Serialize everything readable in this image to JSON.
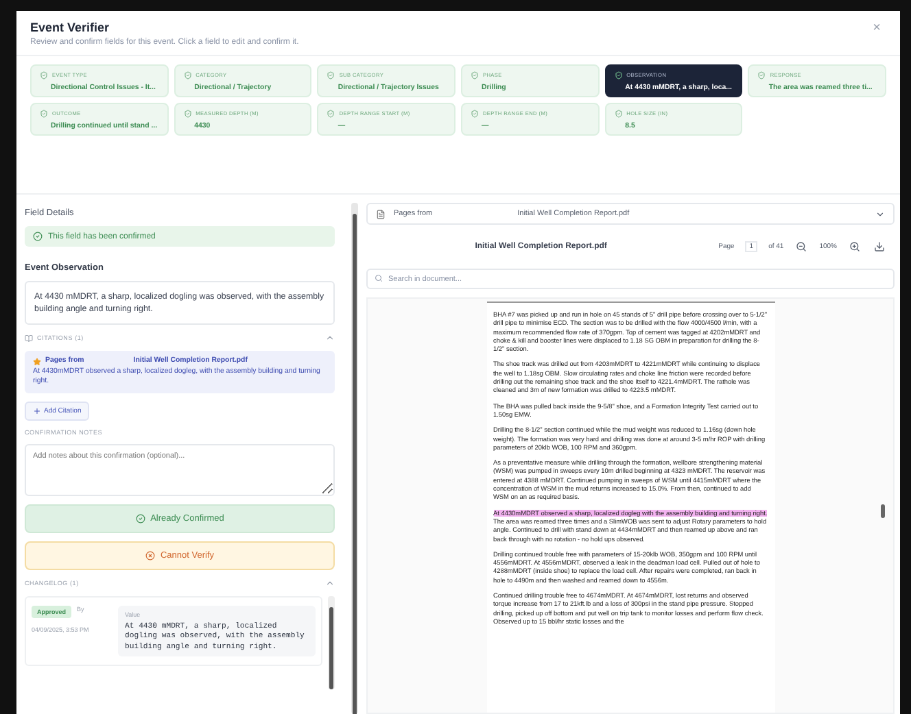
{
  "dialog": {
    "title": "Event Verifier",
    "subtitle": "Review and confirm fields for this event. Click a field to edit and confirm it.",
    "close": "×"
  },
  "fields": [
    {
      "label": "EVENT TYPE",
      "value": "Directional Control Issues - It...",
      "confirmed": true,
      "selected": false
    },
    {
      "label": "CATEGORY",
      "value": "Directional / Trajectory",
      "confirmed": true,
      "selected": false
    },
    {
      "label": "SUB CATEGORY",
      "value": "Directional / Trajectory Issues",
      "confirmed": true,
      "selected": false
    },
    {
      "label": "PHASE",
      "value": "Drilling",
      "confirmed": true,
      "selected": false
    },
    {
      "label": "OBSERVATION",
      "value": "At 4430 mMDRT, a sharp, loca...",
      "confirmed": true,
      "selected": true
    },
    {
      "label": "RESPONSE",
      "value": "The area was reamed three ti...",
      "confirmed": true,
      "selected": false
    },
    {
      "label": "OUTCOME",
      "value": "Drilling continued until stand ...",
      "confirmed": true,
      "selected": false
    },
    {
      "label": "MEASURED DEPTH (M)",
      "value": "4430",
      "confirmed": true,
      "selected": false
    },
    {
      "label": "DEPTH RANGE START (M)",
      "value": "—",
      "confirmed": true,
      "selected": false
    },
    {
      "label": "DEPTH RANGE END (M)",
      "value": "—",
      "confirmed": true,
      "selected": false
    },
    {
      "label": "HOLE SIZE (IN)",
      "value": "8.5",
      "confirmed": true,
      "selected": false
    }
  ],
  "details": {
    "heading": "Field Details",
    "status": "This field has been confirmed",
    "field_title": "Event Observation",
    "value": "At 4430 mMDRT, a sharp, localized dogling was observed, with the assembly building angle and turning right.",
    "citations": {
      "label": "CITATIONS (1)",
      "expanded": true,
      "items": [
        {
          "source": "Pages from",
          "file": "Initial Well Completion Report.pdf",
          "excerpt": "At 4430mMDRT observed a sharp, localized dogleg, with the assembly building and turning right."
        }
      ],
      "add": "Add Citation"
    },
    "notes": {
      "label": "CONFIRMATION NOTES",
      "placeholder": "Add notes about this confirmation (optional)..."
    },
    "buttons": [
      {
        "label": "Already Confirmed",
        "kind": "confirm"
      },
      {
        "label": "Cannot Verify",
        "kind": "reject"
      }
    ],
    "changelog": {
      "label": "CHANGELOG (1)",
      "expanded": true,
      "entries": [
        {
          "status": "Approved",
          "by": "By",
          "date": "04/09/2025, 3:53 PM",
          "value_label": "Value",
          "value": "At 4430 mMDRT, a sharp, localized dogling was observed, with the assembly building angle and turning right."
        }
      ]
    }
  },
  "viewer": {
    "source": "Pages from",
    "file": "Initial Well Completion Report.pdf",
    "title": "Initial Well Completion Report.pdf",
    "page_label": "Page",
    "page": "1",
    "page_total": "of 41",
    "zoom": "100%",
    "search_placeholder": "Search in document...",
    "paragraphs": [
      {
        "text": "BHA #7 was picked up and run in hole on 45 stands of 5\" drill pipe before crossing over to 5-1/2\" drill pipe to minimise ECD. The section was to be drilled with the flow 4000/4500 l/min, with a maximum recommended flow rate of 370gpm. Top of cement was tagged at 4202mMDRT and choke & kill and booster lines were displaced to 1.18 SG OBM in preparation for drilling the 8-1/2\" section."
      },
      {
        "text": "The shoe track was drilled out from 4203mMDRT to 4221mMDRT while continuing to displace the well to 1.18sg OBM. Slow circulating rates and choke line friction were recorded before drilling out the remaining shoe track and the shoe itself to 4221.4mMDRT. The rathole was cleaned and 3m of new formation was drilled to 4223.5 mMDRT."
      },
      {
        "text": "The BHA was pulled back inside the 9-5/8\" shoe, and a Formation Integrity Test carried out to 1.50sg EMW."
      },
      {
        "text": "Drilling the 8-1/2\" section continued while the mud weight was reduced to 1.16sg (down hole weight). The formation was very hard and drilling was done at around 3-5 m/hr ROP with drilling parameters of 20klb WOB, 100 RPM and 360gpm."
      },
      {
        "text": "As a preventative measure while drilling through the formation, wellbore strengthening material (WSM) was pumped in sweeps every 10m drilled beginning at 4323 mMDRT. The reservoir was entered at 4388 mMDRT. Continued pumping in sweeps of WSM until 4415mMDRT where the concentration of WSM in the mud returns increased to 15.0%. From then, continued to add WSM on an as required basis."
      },
      {
        "highlight": "At 4430mMDRT observed a sharp, localized dogleg with the assembly building and turning right.",
        "text": " The area was reamed three times and a SlimWOB was sent to adjust Rotary parameters to hold angle. Continued to drill with stand down at 4434mMDRT and then reamed up above and ran back through with no rotation - no hold ups observed."
      },
      {
        "text": "Drilling continued trouble free with parameters of 15-20klb WOB, 350gpm and 100 RPM until 4556mMDRT. At 4556mMDRT, observed a leak in the deadman load cell. Pulled out of hole to 4288mMDRT (inside shoe) to replace the load cell. After repairs were completed, ran back in hole to 4490m and then washed and reamed down to 4556m."
      },
      {
        "text": "Continued drilling trouble free to 4674mMDRT. At 4674mMDRT, lost returns and observed torque increase from 17 to 21kft.lb and a loss of 300psi in the stand pipe pressure. Stopped drilling, picked up off bottom and put well on trip tank to monitor losses and perform flow check. Observed up to 15 bbl/hr static losses and the"
      }
    ]
  }
}
